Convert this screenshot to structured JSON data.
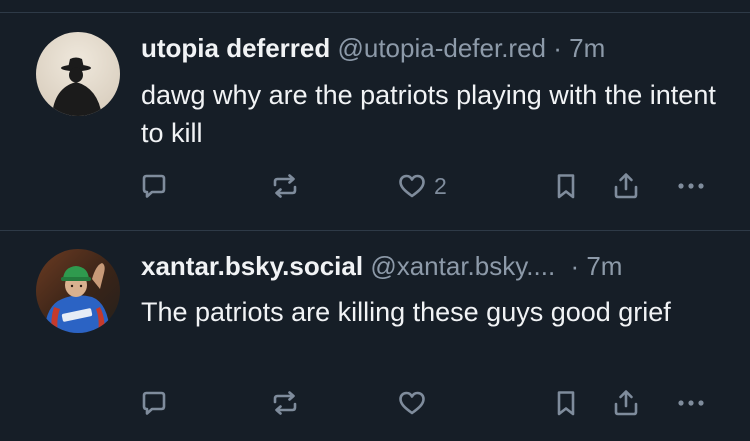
{
  "posts": [
    {
      "author": {
        "display_name": "utopia deferred",
        "handle": "@utopia-defer.red",
        "avatar_icon": "cowboy-silhouette-avatar"
      },
      "separator": "·",
      "time": "7m",
      "text": "dawg why are the patriots playing with the intent to kill",
      "actions": {
        "reply_count": "",
        "repost_count": "",
        "like_count": "2"
      }
    },
    {
      "author": {
        "display_name": "xantar.bsky.social",
        "handle": "@xantar.bsky....",
        "avatar_icon": "person-photo-avatar"
      },
      "separator": "·",
      "time": "7m",
      "text": "The patriots are killing these guys good grief",
      "actions": {
        "reply_count": "",
        "repost_count": "",
        "like_count": ""
      }
    }
  ],
  "colors": {
    "background": "#161e27",
    "text_primary": "#f1f3f5",
    "text_secondary": "#8d9aa9",
    "icon": "#7f8c9c",
    "divider": "#2e3a47"
  }
}
